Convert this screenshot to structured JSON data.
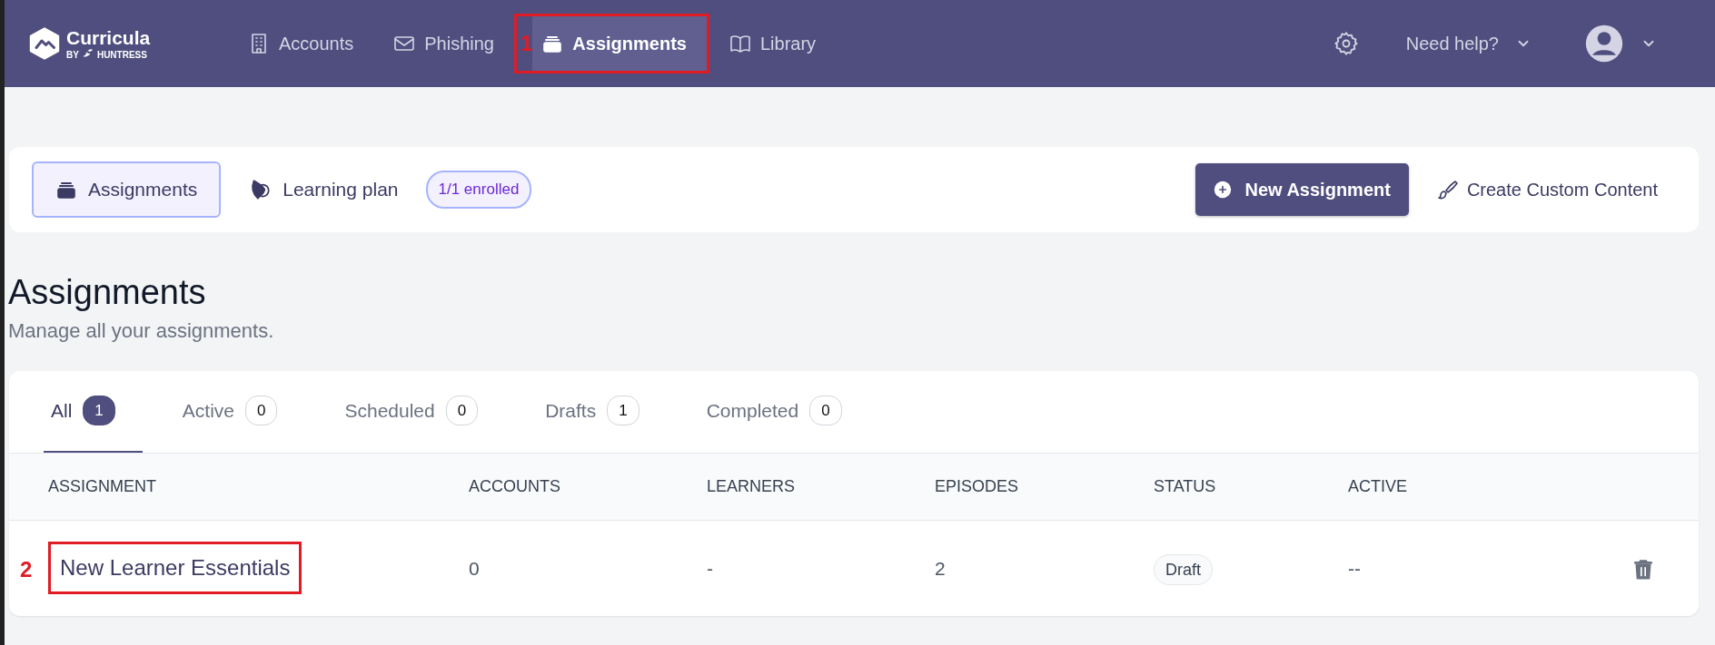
{
  "brand": {
    "name": "Curricula",
    "byline_prefix": "BY",
    "byline": "HUNTRESS"
  },
  "nav": [
    {
      "label": "Accounts",
      "selected": false
    },
    {
      "label": "Phishing",
      "selected": false
    },
    {
      "label": "Assignments",
      "selected": true,
      "callout": "1"
    },
    {
      "label": "Library",
      "selected": false
    }
  ],
  "help": {
    "label": "Need help?"
  },
  "subnav": {
    "tabs": [
      {
        "label": "Assignments",
        "selected": true
      },
      {
        "label": "Learning plan",
        "selected": false,
        "badge": "1/1 enrolled"
      }
    ],
    "primary_button": "New Assignment",
    "link": "Create Custom Content"
  },
  "page": {
    "title": "Assignments",
    "subtitle": "Manage all your assignments."
  },
  "filter_tabs": [
    {
      "label": "All",
      "count": "1",
      "selected": true
    },
    {
      "label": "Active",
      "count": "0",
      "selected": false
    },
    {
      "label": "Scheduled",
      "count": "0",
      "selected": false
    },
    {
      "label": "Drafts",
      "count": "1",
      "selected": false
    },
    {
      "label": "Completed",
      "count": "0",
      "selected": false
    }
  ],
  "table": {
    "columns": [
      "ASSIGNMENT",
      "ACCOUNTS",
      "LEARNERS",
      "EPISODES",
      "STATUS",
      "ACTIVE"
    ],
    "rows": [
      {
        "cells": [
          "New Learner Essentials",
          "0",
          "-",
          "2",
          "Draft",
          "--"
        ],
        "callout": "2"
      }
    ]
  }
}
